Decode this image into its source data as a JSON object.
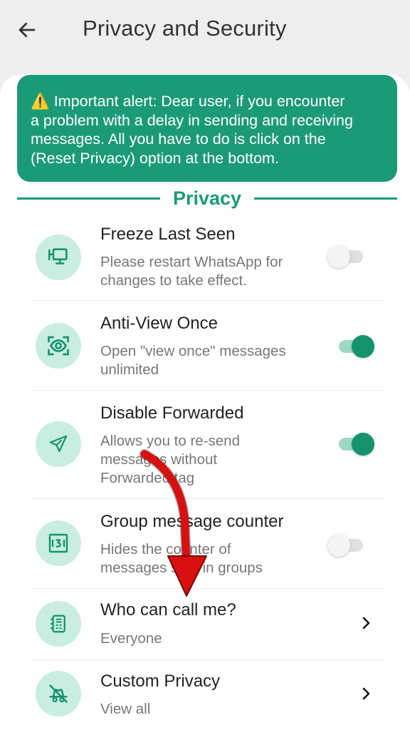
{
  "header": {
    "title": "Privacy and Security"
  },
  "alert": {
    "icon": "warning-icon",
    "lines": [
      "⚠️ Important alert: Dear user, if you encounter",
      "a problem with a delay in sending and receiving",
      "messages. All you have to do is click on the",
      "(Reset Privacy) option at the bottom."
    ]
  },
  "section": {
    "title": "Privacy"
  },
  "rows": [
    {
      "title": "Freeze Last Seen",
      "subtitle": [
        "Please restart WhatsApp for",
        "changes to take effect."
      ],
      "icon": "monitor-icon",
      "toggle": "off"
    },
    {
      "title": "Anti-View Once",
      "subtitle": [
        "Open \"view once\" messages",
        "unlimited"
      ],
      "icon": "eye-scan-icon",
      "toggle": "on"
    },
    {
      "title": "Disable Forwarded",
      "subtitle": [
        "Allows you to re-send",
        "messages without",
        "Forwarded tag"
      ],
      "icon": "send-icon",
      "toggle": "on"
    },
    {
      "title": "Group message counter",
      "subtitle": [
        "Hides the counter of",
        "messages sent in groups"
      ],
      "icon": "counter-icon",
      "toggle": "off"
    },
    {
      "title": "Who can call me?",
      "subtitle": [
        "Everyone"
      ],
      "icon": "phone-book-icon",
      "chevron": true
    },
    {
      "title": "Custom Privacy",
      "subtitle": [
        "View all"
      ],
      "icon": "hidden-icon",
      "chevron": true
    }
  ],
  "colors": {
    "accent": "#1b9a77",
    "icon_bg": "#c9ede0",
    "annotation_arrow": "#d81010"
  }
}
